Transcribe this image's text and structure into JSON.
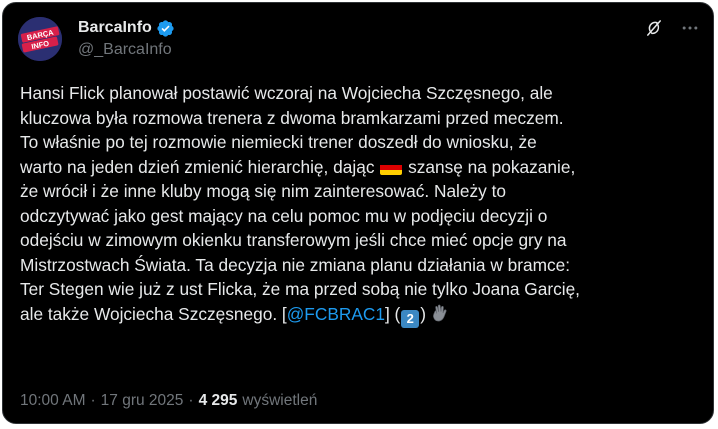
{
  "author": {
    "display_name": "BarcaInfo",
    "handle": "@_BarcaInfo",
    "avatar_text": "BARÇA INFO",
    "verified": true
  },
  "tweet": {
    "lines": [
      "Hansi Flick planował postawić wczoraj na Wojciecha Szczęsnego, ale",
      "kluczowa była rozmowa trenera z dwoma bramkarzami przed meczem.",
      "To właśnie po tej rozmowie niemiecki trener doszedł do wniosku, że",
      "warto na jeden dzień zmienić hierarchię, dając",
      "szansę na pokazanie,",
      "że wrócił i że inne kluby mogą się nim zainteresować. Należy to",
      "odczytywać jako gest mający na celu pomoc mu w podjęciu decyzji o",
      "odejściu w zimowym okienku transferowym jeśli chce mieć opcje gry na",
      "Mistrzostwach Świata. Ta decyzja nie zmiana planu działania w bramce:",
      "Ter Stegen wie już z ust Flicka, że ma przed sobą nie tylko Joana Garcię,",
      "ale także Wojciecha Szczęsnego. [",
      "@FCBRAC1",
      "] (",
      "2",
      ")"
    ],
    "flag_emoji": "german-flag",
    "keycap_emoji": "keycap-2",
    "trailing_emoji": "waving-hand"
  },
  "meta": {
    "time": "10:00 AM",
    "separator": "·",
    "date": "17 gru 2025",
    "views_count": "4 295",
    "views_label": "wyświetleń"
  },
  "colors": {
    "background": "#000000",
    "text": "#e7e9ea",
    "muted": "#71767b",
    "link": "#1d9bf0",
    "verified": "#1d9bf0"
  }
}
